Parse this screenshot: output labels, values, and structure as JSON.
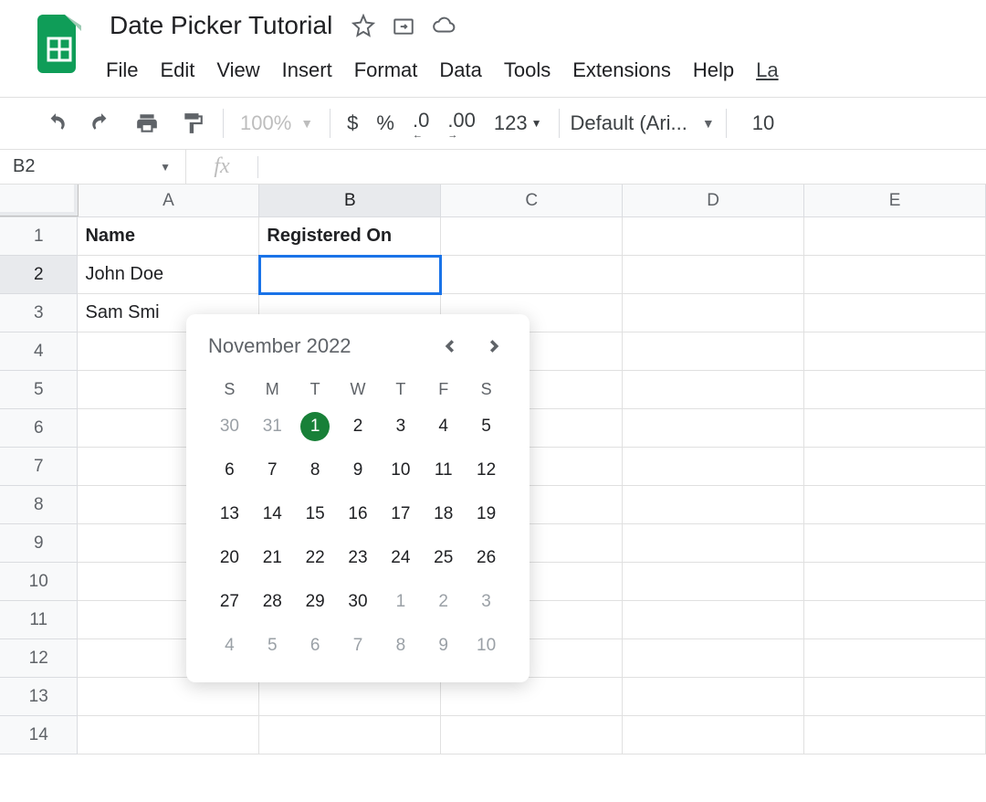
{
  "header": {
    "title": "Date Picker Tutorial",
    "menu": [
      "File",
      "Edit",
      "View",
      "Insert",
      "Format",
      "Data",
      "Tools",
      "Extensions",
      "Help"
    ],
    "lastAction": "La"
  },
  "toolbar": {
    "zoom": "100%",
    "currency": "$",
    "percent": "%",
    "decDecrease": ".0",
    "decIncrease": ".00",
    "moreFormats": "123",
    "fontName": "Default (Ari...",
    "fontSize": "10"
  },
  "formulaBar": {
    "cellRef": "B2",
    "fxLabel": "fx"
  },
  "grid": {
    "columns": [
      "A",
      "B",
      "C",
      "D",
      "E"
    ],
    "rowNumbers": [
      "1",
      "2",
      "3",
      "4",
      "5",
      "6",
      "7",
      "8",
      "9",
      "10",
      "11",
      "12",
      "13",
      "14"
    ],
    "selectedCol": "B",
    "selectedRow": "2",
    "cells": {
      "A1": "Name",
      "B1": "Registered On",
      "A2": "John Doe",
      "A3": "Sam Smi"
    }
  },
  "datepicker": {
    "monthLabel": "November 2022",
    "dow": [
      "S",
      "M",
      "T",
      "W",
      "T",
      "F",
      "S"
    ],
    "days": [
      {
        "n": "30",
        "muted": true
      },
      {
        "n": "31",
        "muted": true
      },
      {
        "n": "1",
        "today": true
      },
      {
        "n": "2"
      },
      {
        "n": "3"
      },
      {
        "n": "4"
      },
      {
        "n": "5"
      },
      {
        "n": "6"
      },
      {
        "n": "7"
      },
      {
        "n": "8"
      },
      {
        "n": "9"
      },
      {
        "n": "10"
      },
      {
        "n": "11"
      },
      {
        "n": "12"
      },
      {
        "n": "13"
      },
      {
        "n": "14"
      },
      {
        "n": "15"
      },
      {
        "n": "16"
      },
      {
        "n": "17"
      },
      {
        "n": "18"
      },
      {
        "n": "19"
      },
      {
        "n": "20"
      },
      {
        "n": "21"
      },
      {
        "n": "22"
      },
      {
        "n": "23"
      },
      {
        "n": "24"
      },
      {
        "n": "25"
      },
      {
        "n": "26"
      },
      {
        "n": "27"
      },
      {
        "n": "28"
      },
      {
        "n": "29"
      },
      {
        "n": "30"
      },
      {
        "n": "1",
        "muted": true
      },
      {
        "n": "2",
        "muted": true
      },
      {
        "n": "3",
        "muted": true
      },
      {
        "n": "4",
        "muted": true
      },
      {
        "n": "5",
        "muted": true
      },
      {
        "n": "6",
        "muted": true
      },
      {
        "n": "7",
        "muted": true
      },
      {
        "n": "8",
        "muted": true
      },
      {
        "n": "9",
        "muted": true
      },
      {
        "n": "10",
        "muted": true
      }
    ]
  }
}
